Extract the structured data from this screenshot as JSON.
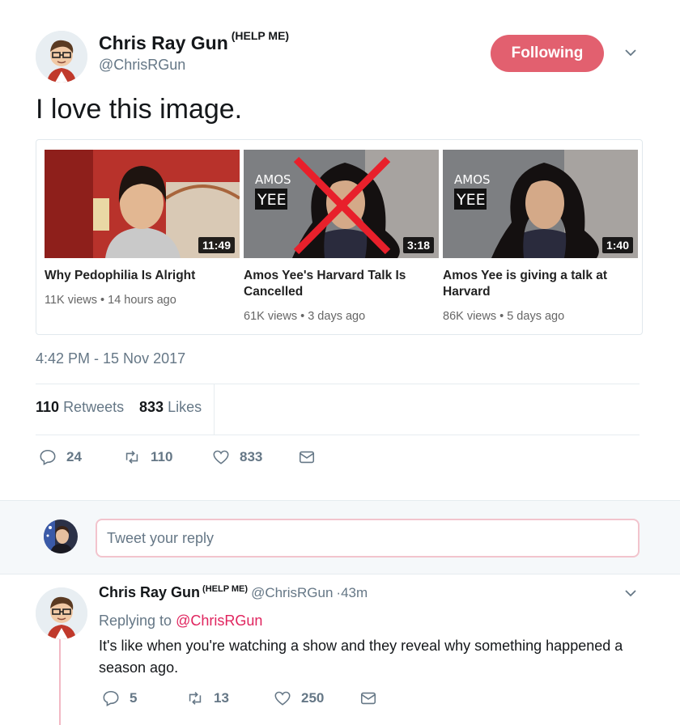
{
  "tweet": {
    "author_name": "Chris Ray Gun",
    "author_sup": "(HELP ME)",
    "author_handle": "@ChrisRGun",
    "follow_label": "Following",
    "text": "I love this image.",
    "timestamp": "4:42 PM - 15 Nov 2017",
    "retweets_count": "110",
    "retweets_label": "Retweets",
    "likes_count": "833",
    "likes_label": "Likes",
    "actions": {
      "reply_count": "24",
      "retweet_count": "110",
      "like_count": "833"
    }
  },
  "videos": [
    {
      "duration": "11:49",
      "title": "Why Pedophilia Is Alright",
      "meta": "11K views • 14 hours ago",
      "overlay_top": "",
      "overlay_bottom": ""
    },
    {
      "duration": "3:18",
      "title": "Amos Yee's Harvard Talk Is Cancelled",
      "meta": "61K views • 3 days ago",
      "overlay_top": "AMOS",
      "overlay_bottom": "YEE"
    },
    {
      "duration": "1:40",
      "title": "Amos Yee is giving a talk at Harvard",
      "meta": "86K views • 5 days ago",
      "overlay_top": "AMOS",
      "overlay_bottom": "YEE"
    }
  ],
  "reply_box": {
    "placeholder": "Tweet your reply"
  },
  "reply": {
    "author_name": "Chris Ray Gun",
    "author_sup": "(HELP ME)",
    "author_handle": "@ChrisRGun",
    "age": "·43m",
    "replying_prefix": "Replying to",
    "replying_handle": "@ChrisRGun",
    "text": "It's like when you're watching a show and they reveal why something happened a season ago.",
    "actions": {
      "reply_count": "5",
      "retweet_count": "13",
      "like_count": "250"
    }
  },
  "colors": {
    "accent": "#e0245e",
    "follow_bg": "#e2606f",
    "muted": "#657786"
  }
}
